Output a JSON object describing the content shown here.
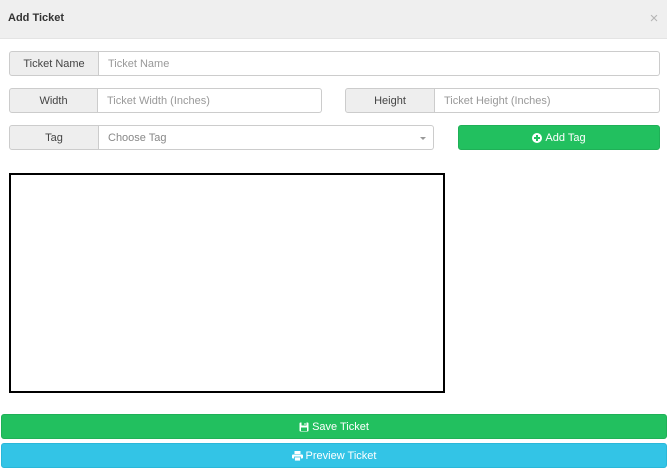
{
  "modal": {
    "title": "Add Ticket",
    "close_glyph": "×"
  },
  "form": {
    "ticket_name": {
      "label": "Ticket Name",
      "placeholder": "Ticket Name",
      "value": ""
    },
    "width": {
      "label": "Width",
      "placeholder": "Ticket Width (Inches)",
      "value": ""
    },
    "height": {
      "label": "Height",
      "placeholder": "Ticket Height (Inches)",
      "value": ""
    },
    "tag": {
      "label": "Tag",
      "placeholder": "Choose Tag"
    }
  },
  "buttons": {
    "add_tag": "Add Tag",
    "save_ticket": "Save Ticket",
    "preview_ticket": "Preview Ticket"
  },
  "icons": {
    "add_tag": "plus-circle-icon",
    "save_ticket": "floppy-disk-icon",
    "preview_ticket": "printer-icon"
  },
  "colors": {
    "success": "#22c05f",
    "info": "#33c4e6",
    "header_bg": "#efefef"
  }
}
